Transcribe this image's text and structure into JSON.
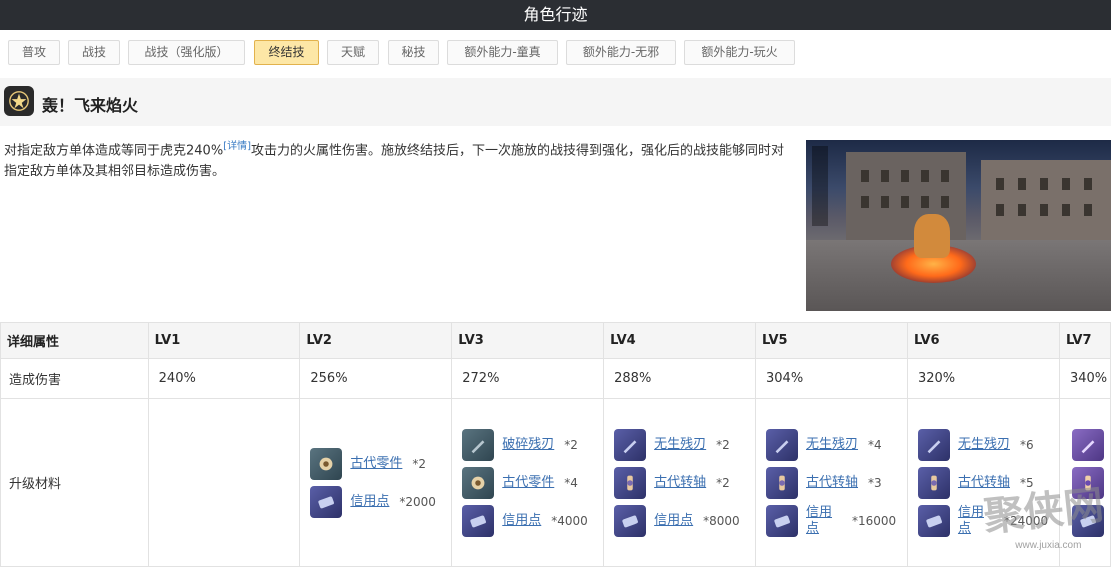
{
  "window": {
    "title": "角色行迹"
  },
  "tabs": [
    {
      "label": "普攻",
      "active": false
    },
    {
      "label": "战技",
      "active": false
    },
    {
      "label": "战技（强化版）",
      "active": false
    },
    {
      "label": "终结技",
      "active": true
    },
    {
      "label": "天赋",
      "active": false
    },
    {
      "label": "秘技",
      "active": false
    },
    {
      "label": "额外能力-童真",
      "active": false
    },
    {
      "label": "额外能力-无邪",
      "active": false
    },
    {
      "label": "额外能力-玩火",
      "active": false
    }
  ],
  "skill": {
    "icon": "star-burst-icon",
    "name": "轰！飞来焰火",
    "description_part1": "对指定敌方单体造成等同于虎克240%",
    "detail_link": "[详情]",
    "description_part2": "攻击力的火属性伤害。施放终结技后，下一次施放的战技得到强化，强化后的战技能够同时对指定敌方单体及其相邻目标造成伤害。"
  },
  "table": {
    "header_label": "详细属性",
    "levels": [
      "LV1",
      "LV2",
      "LV3",
      "LV4",
      "LV5",
      "LV6",
      "LV7"
    ],
    "damage_label": "造成伤害",
    "damage": [
      "240%",
      "256%",
      "272%",
      "288%",
      "304%",
      "320%",
      "340%"
    ],
    "materials_label": "升级材料",
    "materials": [
      [],
      [
        {
          "name": "古代零件",
          "qty": "*2",
          "icon": "gear-fragment-icon",
          "color": "teal"
        },
        {
          "name": "信用点",
          "qty": "*2000",
          "icon": "credit-icon",
          "color": "blue"
        }
      ],
      [
        {
          "name": "破碎残刃",
          "qty": "*2",
          "icon": "broken-blade-icon",
          "color": "teal"
        },
        {
          "name": "古代零件",
          "qty": "*4",
          "icon": "gear-fragment-icon",
          "color": "teal"
        },
        {
          "name": "信用点",
          "qty": "*4000",
          "icon": "credit-icon",
          "color": "blue"
        }
      ],
      [
        {
          "name": "无生残刃",
          "qty": "*2",
          "icon": "lifeless-blade-icon",
          "color": "blue"
        },
        {
          "name": "古代转轴",
          "qty": "*2",
          "icon": "spindle-icon",
          "color": "blue"
        },
        {
          "name": "信用点",
          "qty": "*8000",
          "icon": "credit-icon",
          "color": "blue"
        }
      ],
      [
        {
          "name": "无生残刃",
          "qty": "*4",
          "icon": "lifeless-blade-icon",
          "color": "blue"
        },
        {
          "name": "古代转轴",
          "qty": "*3",
          "icon": "spindle-icon",
          "color": "blue"
        },
        {
          "name": "信用点",
          "qty": "*16000",
          "icon": "credit-icon",
          "color": "blue"
        }
      ],
      [
        {
          "name": "无生残刃",
          "qty": "*6",
          "icon": "lifeless-blade-icon",
          "color": "blue"
        },
        {
          "name": "古代转轴",
          "qty": "*5",
          "icon": "spindle-icon",
          "color": "blue"
        },
        {
          "name": "信用点",
          "qty": "*24000",
          "icon": "credit-icon",
          "color": "blue"
        }
      ],
      [
        {
          "name": "",
          "qty": "",
          "icon": "blade-icon",
          "color": "purple"
        },
        {
          "name": "",
          "qty": "",
          "icon": "engine-icon",
          "color": "purple"
        },
        {
          "name": "",
          "qty": "",
          "icon": "credit-icon",
          "color": "blue"
        }
      ]
    ]
  },
  "watermark": {
    "text": "聚侠网",
    "site": "www.juxia.com"
  }
}
